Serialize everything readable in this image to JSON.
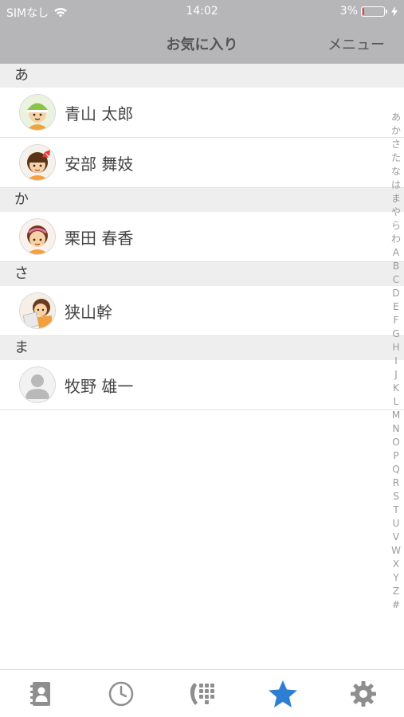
{
  "status_bar": {
    "carrier": "SIMなし",
    "time": "14:02",
    "battery_text": "3%",
    "battery_level": 0.03,
    "icons": [
      "wifi-icon",
      "battery-icon",
      "charging-bolt-icon"
    ]
  },
  "nav": {
    "title": "お気に入り",
    "menu_label": "メニュー"
  },
  "sections": [
    {
      "header": "あ",
      "contacts": [
        {
          "name": "青山 太郎",
          "avatar": "boy-green-cap-avatar"
        },
        {
          "name": "安部 舞妓",
          "avatar": "girl-red-bow-avatar"
        }
      ]
    },
    {
      "header": "か",
      "contacts": [
        {
          "name": "栗田 春香",
          "avatar": "girl-pink-band-avatar"
        }
      ]
    },
    {
      "header": "さ",
      "contacts": [
        {
          "name": "狭山幹",
          "avatar": "girl-reading-avatar"
        }
      ]
    },
    {
      "header": "ま",
      "contacts": [
        {
          "name": "牧野 雄一",
          "avatar": "default-person-avatar"
        }
      ]
    }
  ],
  "index": [
    "あ",
    "か",
    "さ",
    "た",
    "な",
    "は",
    "ま",
    "や",
    "ら",
    "わ",
    "A",
    "B",
    "C",
    "D",
    "E",
    "F",
    "G",
    "H",
    "I",
    "J",
    "K",
    "L",
    "M",
    "N",
    "O",
    "P",
    "Q",
    "R",
    "S",
    "T",
    "U",
    "V",
    "W",
    "X",
    "Y",
    "Z",
    "#"
  ],
  "tabs": [
    {
      "icon": "contacts-book-icon",
      "active": false
    },
    {
      "icon": "clock-history-icon",
      "active": false
    },
    {
      "icon": "dialpad-icon",
      "active": false
    },
    {
      "icon": "star-favorites-icon",
      "active": true
    },
    {
      "icon": "gear-settings-icon",
      "active": false
    }
  ],
  "colors": {
    "bar_gray": "#b6b6b8",
    "tab_inactive": "#8e8e8e",
    "tab_active": "#2e7fd4",
    "battery_low": "#ff3b30"
  }
}
